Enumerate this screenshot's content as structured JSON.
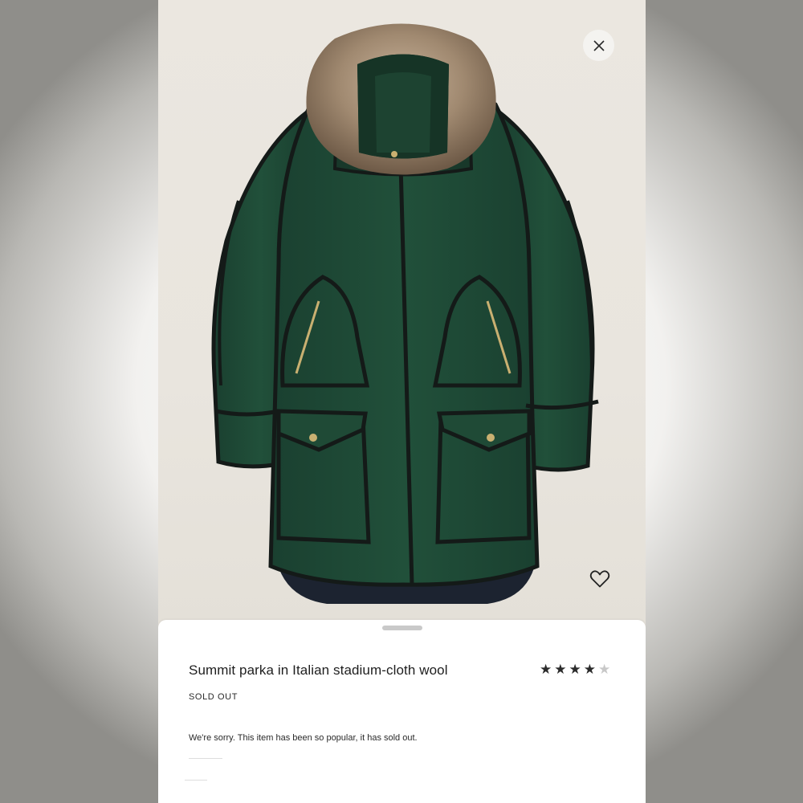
{
  "product": {
    "title": "Summit parka in Italian stadium-cloth wool",
    "status": "SOLD OUT",
    "message": "We're sorry. This item has been so popular, it has sold out.",
    "rating": 4,
    "rating_max": 5
  },
  "icons": {
    "close": "close-icon",
    "favorite": "heart-icon",
    "star": "star-icon"
  },
  "colors": {
    "coat_green": "#1f4a36",
    "piping": "#141a18",
    "fur": "#a08970",
    "background": "#e9e5de"
  }
}
